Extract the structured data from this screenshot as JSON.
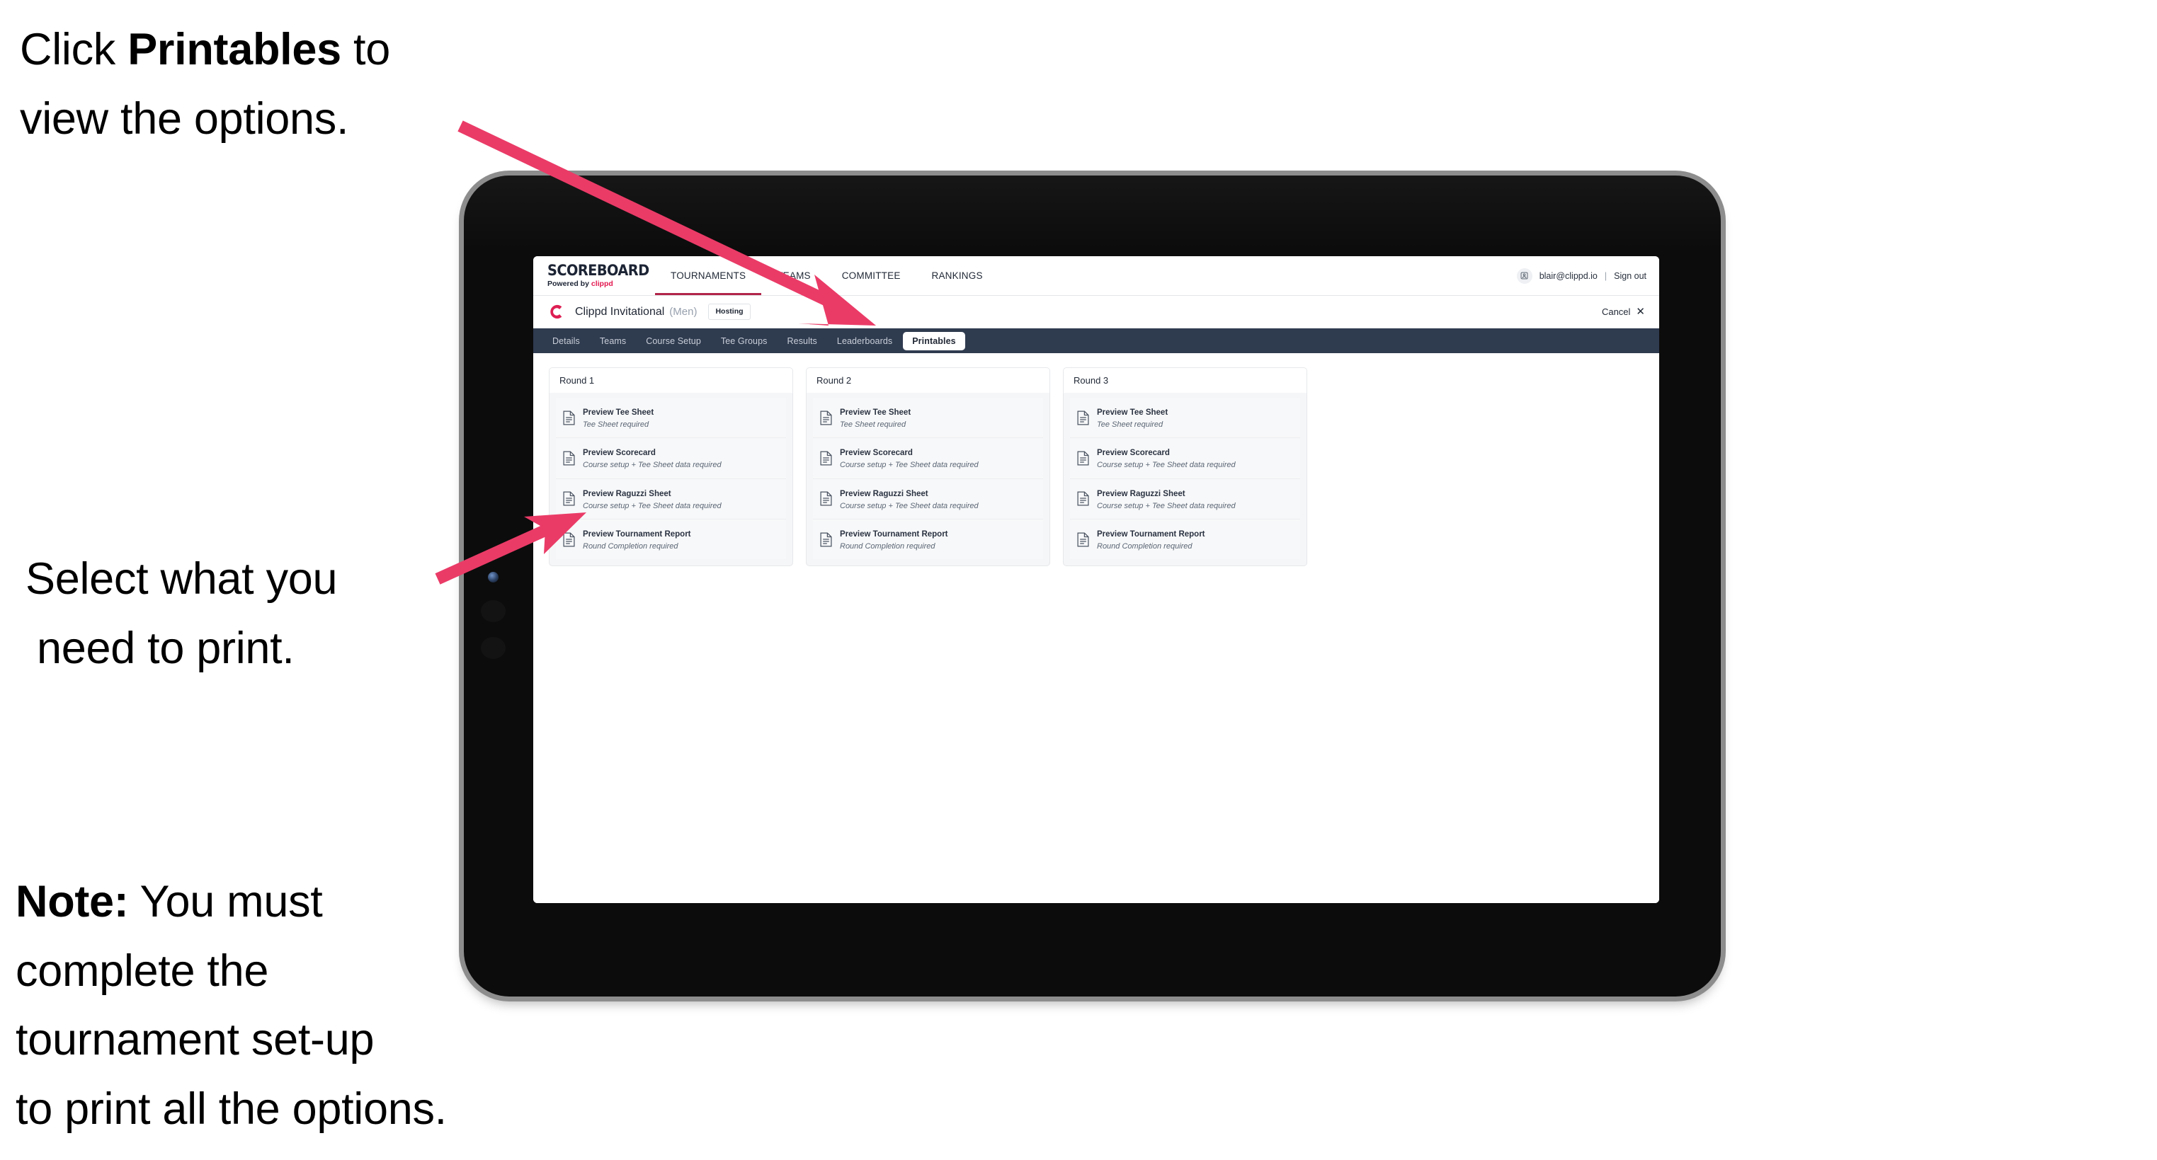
{
  "annotations": {
    "click_printables": {
      "pre": "Click ",
      "bold": "Printables",
      "post": " to",
      "line2": "view the options."
    },
    "select_print": {
      "line1": "Select what you",
      "line2": "need to print."
    },
    "note": {
      "bold": "Note:",
      "line1_rest": " You must",
      "line2": "complete the",
      "line3": "tournament set-up",
      "line4": "to print all the options."
    },
    "arrow_color": "#ea3b67"
  },
  "app": {
    "brand": {
      "title": "SCOREBOARD",
      "powered_prefix": "Powered by ",
      "powered_brand": "clippd"
    },
    "top_nav": [
      {
        "label": "TOURNAMENTS",
        "active": true
      },
      {
        "label": "TEAMS",
        "active": false
      },
      {
        "label": "COMMITTEE",
        "active": false
      },
      {
        "label": "RANKINGS",
        "active": false
      }
    ],
    "account": {
      "avatar_icon": "user-avatar-icon",
      "email": "blair@clippd.io",
      "separator": "|",
      "sign_out": "Sign out"
    },
    "tournament": {
      "logo_icon": "clippd-c-logo-icon",
      "name": "Clippd Invitational",
      "gender": "(Men)",
      "status_badge": "Hosting",
      "cancel_label": "Cancel",
      "cancel_icon": "close-x-icon"
    },
    "tabs": [
      {
        "label": "Details",
        "active": false
      },
      {
        "label": "Teams",
        "active": false
      },
      {
        "label": "Course Setup",
        "active": false
      },
      {
        "label": "Tee Groups",
        "active": false
      },
      {
        "label": "Results",
        "active": false
      },
      {
        "label": "Leaderboards",
        "active": false
      },
      {
        "label": "Printables",
        "active": true
      }
    ],
    "colors": {
      "nav_bar": "#2f3b4f",
      "brand_accent": "#e2174f",
      "active_underline": "#b2254a"
    },
    "rounds": [
      {
        "title": "Round 1",
        "items": [
          {
            "icon": "document-icon",
            "title": "Preview Tee Sheet",
            "subtitle": "Tee Sheet required"
          },
          {
            "icon": "document-icon",
            "title": "Preview Scorecard",
            "subtitle": "Course setup + Tee Sheet data required"
          },
          {
            "icon": "document-icon",
            "title": "Preview Raguzzi Sheet",
            "subtitle": "Course setup + Tee Sheet data required"
          },
          {
            "icon": "document-icon",
            "title": "Preview Tournament Report",
            "subtitle": "Round Completion required"
          }
        ]
      },
      {
        "title": "Round 2",
        "items": [
          {
            "icon": "document-icon",
            "title": "Preview Tee Sheet",
            "subtitle": "Tee Sheet required"
          },
          {
            "icon": "document-icon",
            "title": "Preview Scorecard",
            "subtitle": "Course setup + Tee Sheet data required"
          },
          {
            "icon": "document-icon",
            "title": "Preview Raguzzi Sheet",
            "subtitle": "Course setup + Tee Sheet data required"
          },
          {
            "icon": "document-icon",
            "title": "Preview Tournament Report",
            "subtitle": "Round Completion required"
          }
        ]
      },
      {
        "title": "Round 3",
        "items": [
          {
            "icon": "document-icon",
            "title": "Preview Tee Sheet",
            "subtitle": "Tee Sheet required"
          },
          {
            "icon": "document-icon",
            "title": "Preview Scorecard",
            "subtitle": "Course setup + Tee Sheet data required"
          },
          {
            "icon": "document-icon",
            "title": "Preview Raguzzi Sheet",
            "subtitle": "Course setup + Tee Sheet data required"
          },
          {
            "icon": "document-icon",
            "title": "Preview Tournament Report",
            "subtitle": "Round Completion required"
          }
        ]
      }
    ]
  }
}
